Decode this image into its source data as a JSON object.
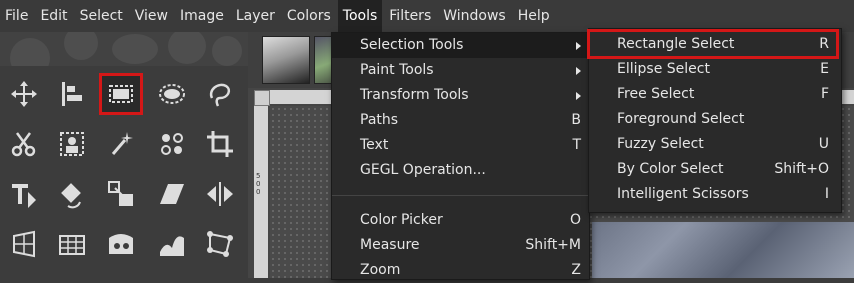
{
  "menubar": {
    "items": [
      "File",
      "Edit",
      "Select",
      "View",
      "Image",
      "Layer",
      "Colors",
      "Tools",
      "Filters",
      "Windows",
      "Help"
    ],
    "active_index": 7
  },
  "tools_menu": {
    "items": [
      {
        "label": "Selection Tools",
        "accel": "",
        "submenu": true
      },
      {
        "label": "Paint Tools",
        "accel": "",
        "submenu": true
      },
      {
        "label": "Transform Tools",
        "accel": "",
        "submenu": true
      },
      {
        "label": "Paths",
        "accel": "B",
        "submenu": false
      },
      {
        "label": "Text",
        "accel": "T",
        "submenu": false
      },
      {
        "label": "GEGL Operation...",
        "accel": "",
        "submenu": false
      },
      {
        "label": "Color Picker",
        "accel": "O",
        "submenu": false
      },
      {
        "label": "Measure",
        "accel": "Shift+M",
        "submenu": false
      },
      {
        "label": "Zoom",
        "accel": "Z",
        "submenu": false
      }
    ]
  },
  "selection_submenu": {
    "items": [
      {
        "label": "Rectangle Select",
        "accel": "R"
      },
      {
        "label": "Ellipse Select",
        "accel": "E"
      },
      {
        "label": "Free Select",
        "accel": "F"
      },
      {
        "label": "Foreground Select",
        "accel": ""
      },
      {
        "label": "Fuzzy Select",
        "accel": "U"
      },
      {
        "label": "By Color Select",
        "accel": "Shift+O"
      },
      {
        "label": "Intelligent Scissors",
        "accel": "I"
      }
    ]
  },
  "ruler": {
    "left_ticks": [
      "5",
      "0",
      "0"
    ]
  },
  "toolbox": {
    "tools": [
      "move-tool-icon",
      "align-tool-icon",
      "rectangle-select-tool-icon",
      "ellipse-select-tool-icon",
      "free-select-tool-icon",
      "scissors-select-tool-icon",
      "foreground-select-tool-icon",
      "fuzzy-select-tool-icon",
      "by-color-select-tool-icon",
      "crop-tool-icon",
      "text-transform-tool-icon",
      "rotate-tool-icon",
      "scale-tool-icon",
      "shear-tool-icon",
      "flip-tool-icon",
      "perspective-tool-icon",
      "cage-transform-tool-icon",
      "warp-transform-tool-icon",
      "wave-transform-tool-icon",
      "handle-transform-tool-icon"
    ],
    "active_tool_index": 2
  },
  "colors": {
    "highlight": "#d41717",
    "menu_bg": "#2a2a2a"
  }
}
